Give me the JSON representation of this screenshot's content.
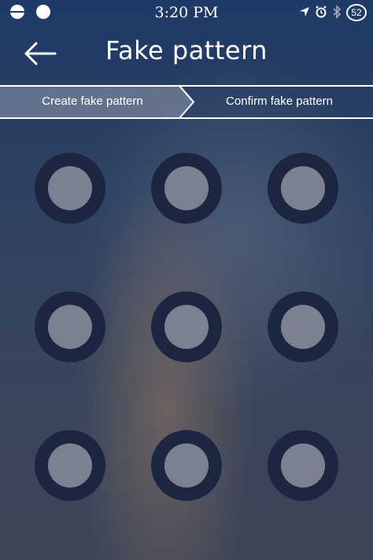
{
  "status_bar": {
    "time": "3:20 PM",
    "battery_level": "52",
    "icons": [
      "location-arrow-icon",
      "alarm-icon",
      "bluetooth-icon"
    ]
  },
  "header": {
    "title": "Fake pattern",
    "back_icon": "arrow-left-icon"
  },
  "steps": [
    {
      "label": "Create fake pattern",
      "active": true
    },
    {
      "label": "Confirm fake pattern",
      "active": false
    }
  ],
  "pattern": {
    "rows": 3,
    "cols": 3,
    "nodes": [
      1,
      2,
      3,
      4,
      5,
      6,
      7,
      8,
      9
    ]
  },
  "colors": {
    "node_ring": "#1c2640",
    "node_fill": "#7c8192",
    "active_step_bg": "#6e7b93"
  }
}
